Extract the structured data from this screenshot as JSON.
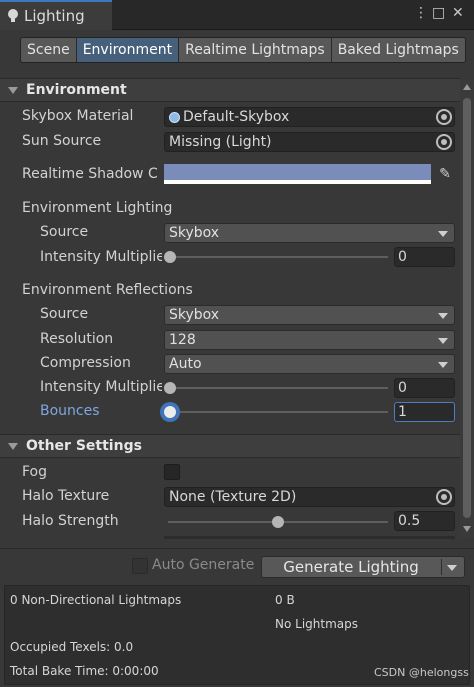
{
  "window": {
    "title": "Lighting",
    "kebab": "⋮",
    "maximize": "□",
    "close": "✕"
  },
  "tabs": [
    {
      "label": "Scene"
    },
    {
      "label": "Environment"
    },
    {
      "label": "Realtime Lightmaps"
    },
    {
      "label": "Baked Lightmaps"
    }
  ],
  "environment": {
    "header": "Environment",
    "skybox_material": {
      "label": "Skybox Material",
      "value": "Default-Skybox"
    },
    "sun_source": {
      "label": "Sun Source",
      "value": "Missing (Light)"
    },
    "realtime_shadow": {
      "label": "Realtime Shadow C",
      "color": "#7a8cba"
    },
    "env_lighting": {
      "title": "Environment Lighting",
      "source": {
        "label": "Source",
        "value": "Skybox"
      },
      "intensity": {
        "label": "Intensity Multiplie",
        "value": "0",
        "level": 0
      }
    },
    "env_reflections": {
      "title": "Environment Reflections",
      "source": {
        "label": "Source",
        "value": "Skybox"
      },
      "resolution": {
        "label": "Resolution",
        "value": "128"
      },
      "compression": {
        "label": "Compression",
        "value": "Auto"
      },
      "intensity": {
        "label": "Intensity Multiplie",
        "value": "0",
        "level": 0
      },
      "bounces": {
        "label": "Bounces",
        "value": "1",
        "level": 0
      }
    }
  },
  "other_settings": {
    "header": "Other Settings",
    "fog": {
      "label": "Fog"
    },
    "halo_texture": {
      "label": "Halo Texture",
      "value": "None (Texture 2D)"
    },
    "halo_strength": {
      "label": "Halo Strength",
      "value": "0.5",
      "level": 0.5
    }
  },
  "footer": {
    "auto_generate": "Auto Generate",
    "generate_button": "Generate Lighting"
  },
  "stats": {
    "lightmaps": "0 Non-Directional Lightmaps",
    "size": "0 B",
    "no_lightmaps": "No Lightmaps",
    "occupied": "Occupied Texels: 0.0",
    "bake_time": "Total Bake Time: 0:00:00"
  },
  "watermark": "CSDN @helongss",
  "colors": {
    "accent": "#3a79bb",
    "active_tab": "#46607c",
    "highlight_label": "#7ea6e0"
  }
}
